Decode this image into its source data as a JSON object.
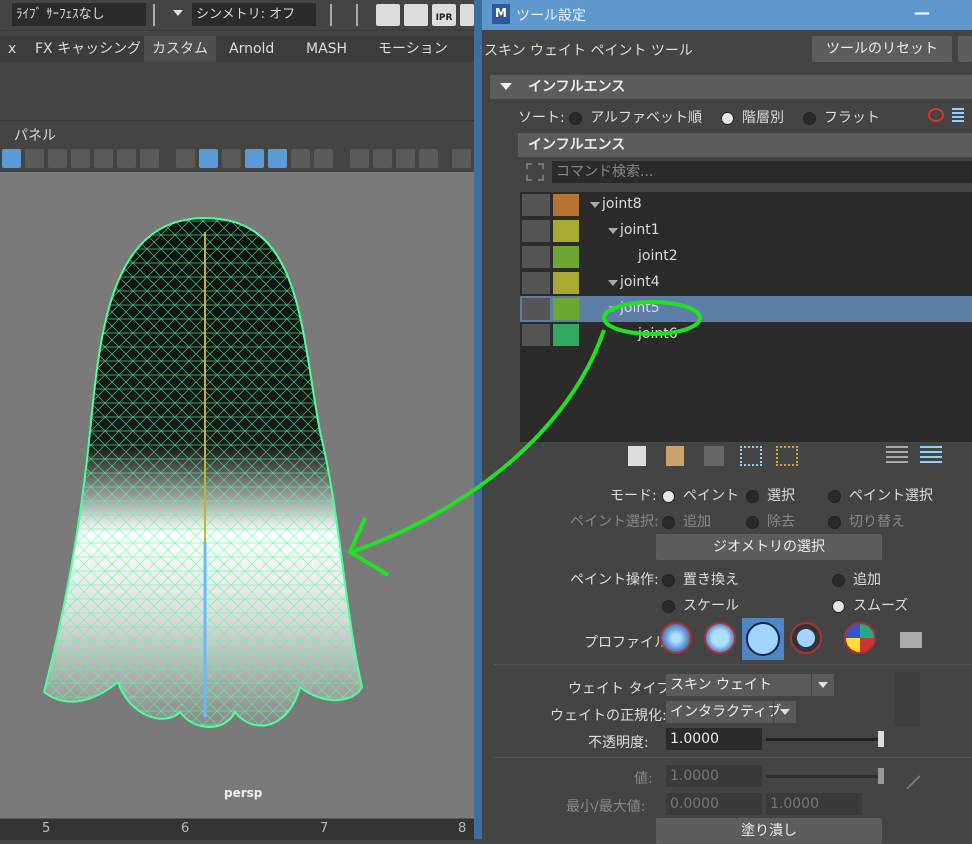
{
  "top_toolbar": {
    "live_surface": "ﾗｲﾌﾞ ｻｰﾌｪｽなし",
    "symmetry": "シンメトリ: オフ",
    "ipr_label": "IPR"
  },
  "shelf_tabs": [
    {
      "label": "x"
    },
    {
      "label": "FX キャッシング"
    },
    {
      "label": "カスタム",
      "active": true
    },
    {
      "label": "Arnold"
    },
    {
      "label": "MASH"
    },
    {
      "label": "モーション グラフィ"
    }
  ],
  "viewport": {
    "panel_menu": "パネル",
    "camera_label": "persp",
    "timeline_ticks": [
      "5",
      "6",
      "7",
      "8"
    ]
  },
  "tool_settings": {
    "window_title": "ツール設定",
    "app_badge": "M",
    "minimize_symbol": "—",
    "tool_name": "スキン ウェイト ペイント ツール",
    "reset_button": "ツールのリセット",
    "influence_section": "インフルエンス",
    "sort_label": "ソート:",
    "sort_options": [
      {
        "label": "アルファベット順",
        "selected": false
      },
      {
        "label": "階層別",
        "selected": true
      },
      {
        "label": "フラット",
        "selected": false
      }
    ],
    "influence_header": "インフルエンス",
    "search_placeholder": "コマンド検索...",
    "joints": [
      {
        "name": "joint8",
        "color": "#b87333",
        "depth": 0,
        "expanded": true
      },
      {
        "name": "joint1",
        "color": "#a8a832",
        "depth": 1,
        "expanded": true
      },
      {
        "name": "joint2",
        "color": "#6aa832",
        "depth": 2,
        "expanded": false
      },
      {
        "name": "joint4",
        "color": "#a8a832",
        "depth": 1,
        "expanded": true
      },
      {
        "name": "joint5",
        "color": "#6aa832",
        "depth": 1,
        "expanded": true,
        "selected": true
      },
      {
        "name": "joint6",
        "color": "#32a860",
        "depth": 2,
        "expanded": false
      }
    ],
    "mode_label": "モード:",
    "mode_options": [
      {
        "label": "ペイント",
        "selected": true
      },
      {
        "label": "選択",
        "selected": false
      },
      {
        "label": "ペイント選択",
        "selected": false
      }
    ],
    "paint_select_label": "ペイント選択:",
    "paint_select_options": [
      {
        "label": "追加"
      },
      {
        "label": "除去"
      },
      {
        "label": "切り替え"
      }
    ],
    "select_geometry_button": "ジオメトリの選択",
    "paint_op_label": "ペイント操作:",
    "paint_ops": [
      {
        "label": "置き換え",
        "selected": false
      },
      {
        "label": "追加",
        "selected": false
      },
      {
        "label": "スケール",
        "selected": false
      },
      {
        "label": "スムーズ",
        "selected": true
      }
    ],
    "profile_label": "プロファイル:",
    "weight_type_label": "ウェイト タイプ:",
    "weight_type_value": "スキン ウェイト",
    "normalize_label": "ウェイトの正規化:",
    "normalize_value": "インタラクティブ",
    "opacity_label": "不透明度:",
    "opacity_value": "1.0000",
    "opacity_level": 1.0,
    "value_label": "値:",
    "value_value": "1.0000",
    "minmax_label": "最小/最大値:",
    "min_value": "0.0000",
    "max_value": "1.0000",
    "flood_button": "塗り潰し"
  }
}
